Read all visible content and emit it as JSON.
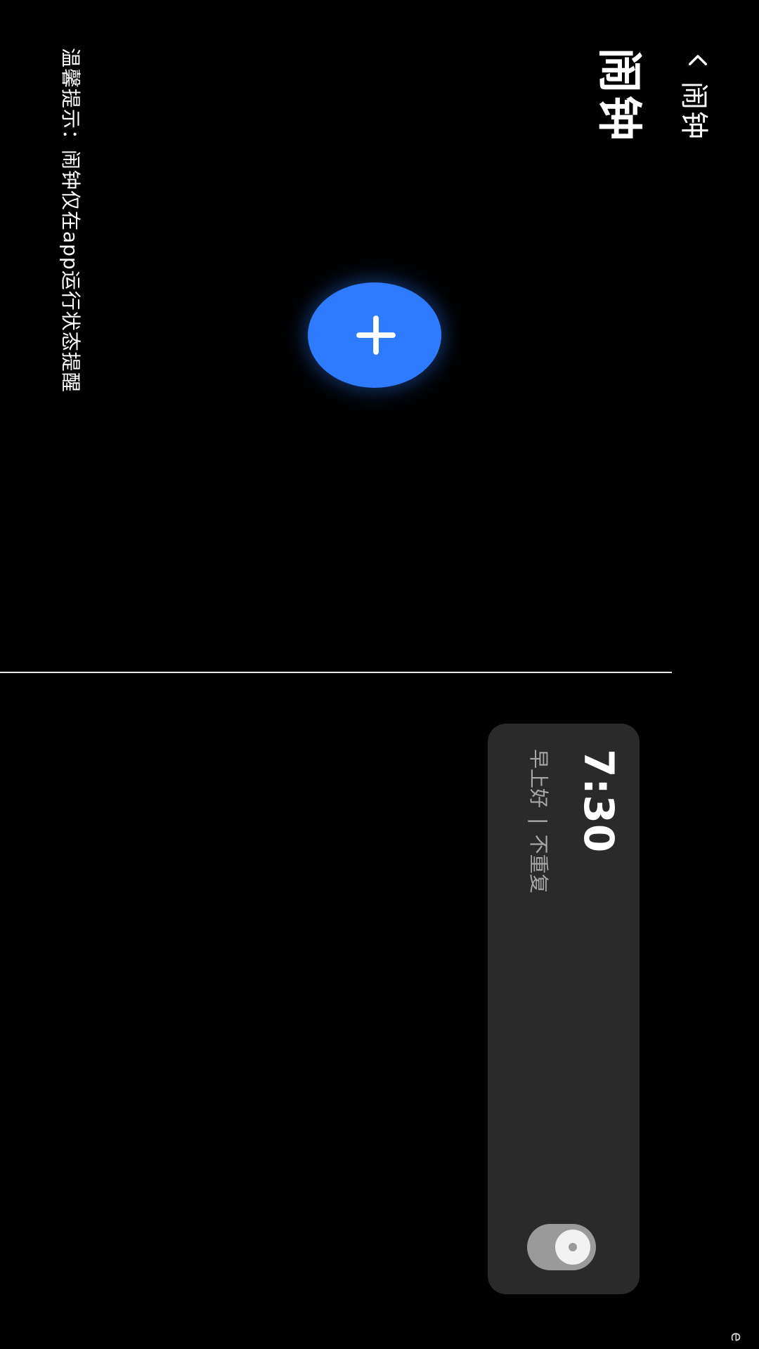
{
  "header": {
    "back_label": "闹钟",
    "title": "闹钟"
  },
  "tip": {
    "text": "温馨提示：闹钟仅在app运行状态提醒"
  },
  "fab": {
    "icon": "plus-icon"
  },
  "alarms": [
    {
      "time": "7:30",
      "label": "早上好",
      "separator": "|",
      "repeat": "不重复",
      "enabled": false
    }
  ],
  "corner_text": "e",
  "colors": {
    "background": "#000000",
    "accent": "#2f7bff",
    "card": "#2a2a2a",
    "toggle_off": "#9a9a9a"
  }
}
